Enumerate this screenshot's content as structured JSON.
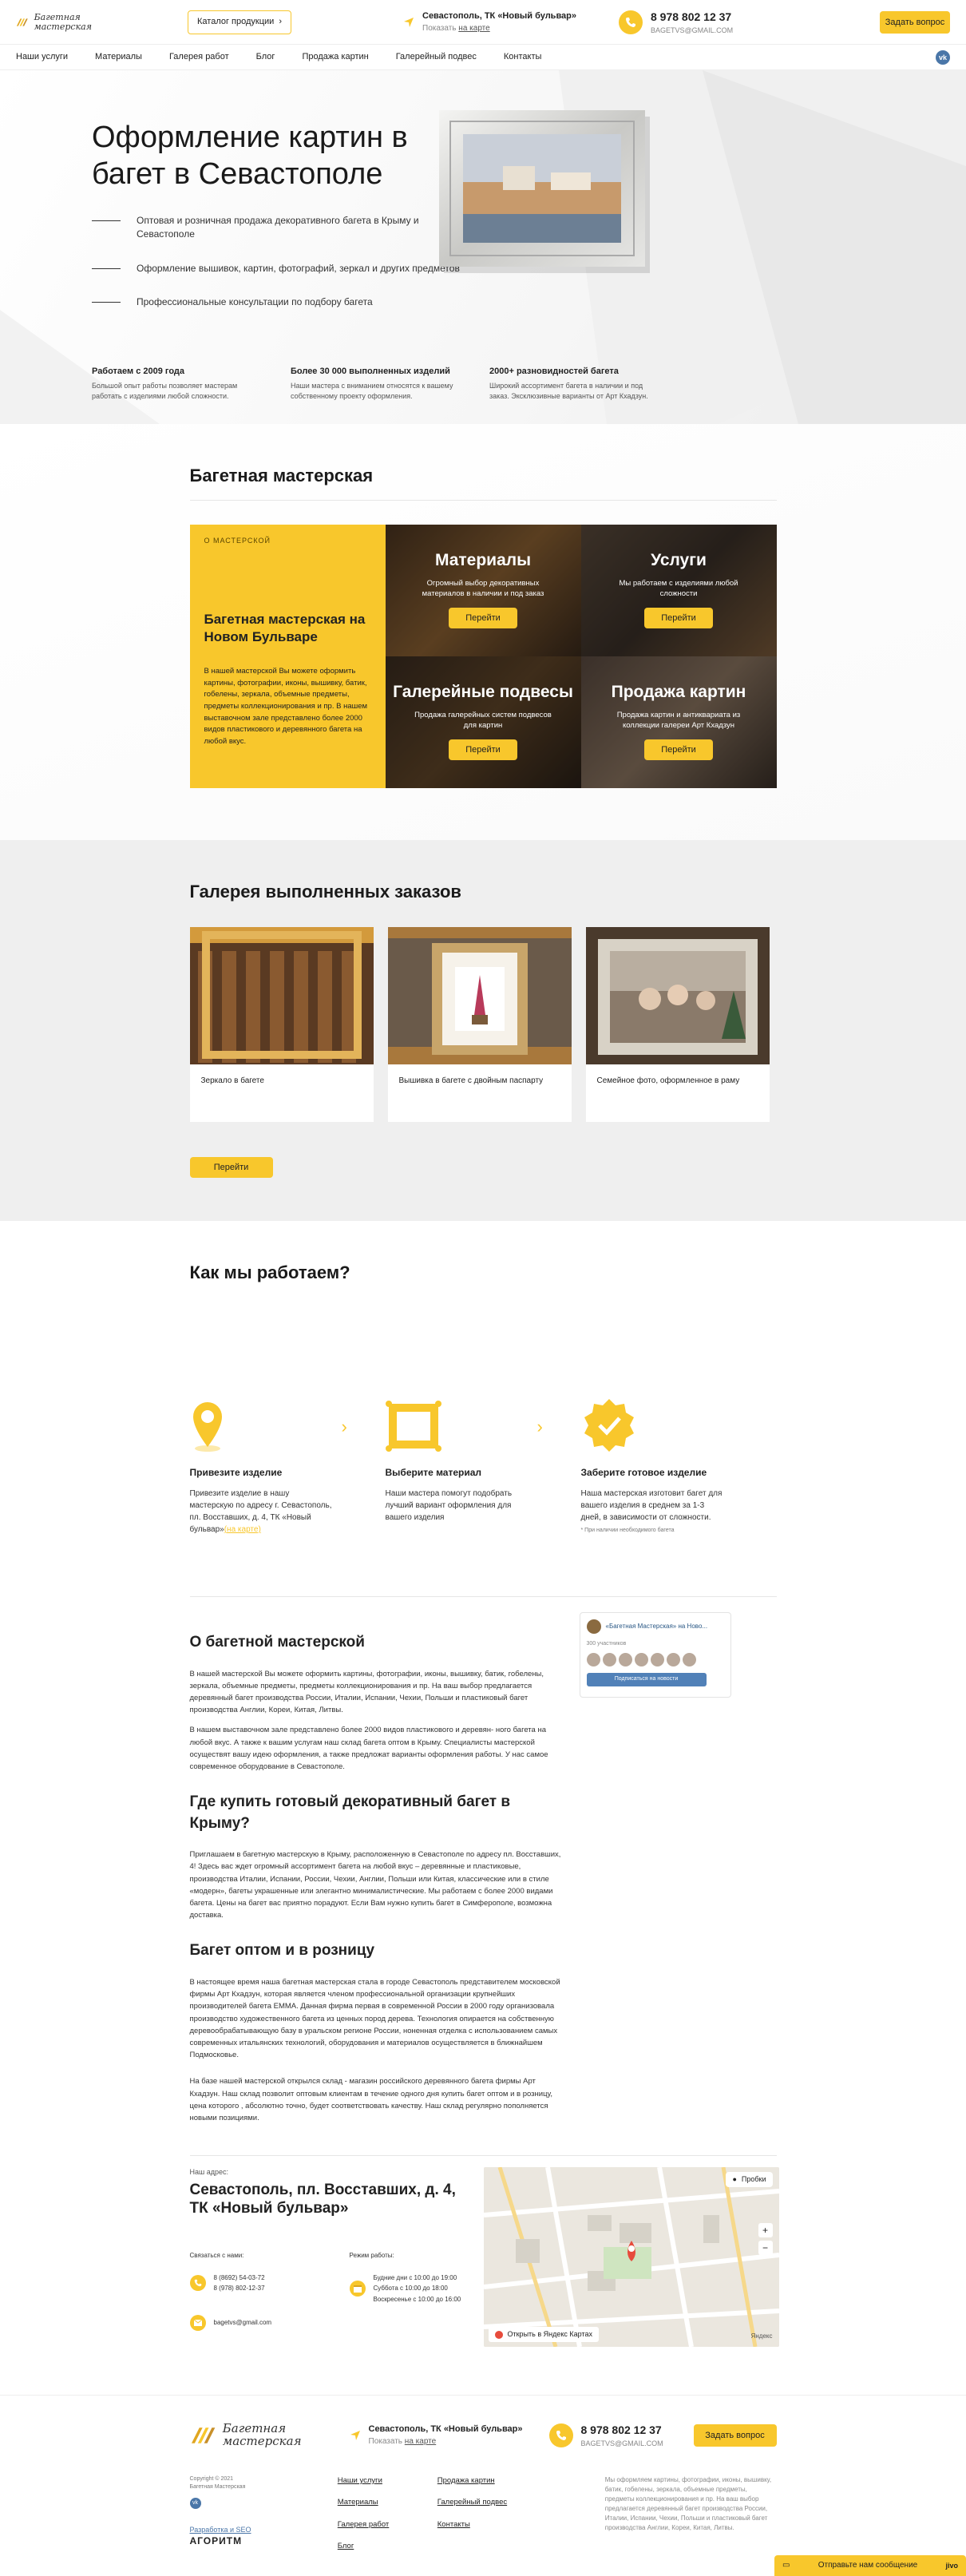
{
  "header": {
    "logo_line1": "Багетная",
    "logo_line2": "мастерская",
    "catalog_label": "Каталог продукции",
    "address_title": "Севастополь, ТК «Новый бульвар»",
    "address_show": "Показать",
    "address_map_link": "на карте",
    "phone": "8 978 802 12 37",
    "email": "BAGETVS@GMAIL.COM",
    "ask_label": "Задать вопрос"
  },
  "nav": {
    "items": [
      "Наши услуги",
      "Материалы",
      "Галерея работ",
      "Блог",
      "Продажа картин",
      "Галерейный подвес",
      "Контакты"
    ],
    "vk": "vk"
  },
  "hero": {
    "title": "Оформление картин в багет в Севастополе",
    "bullets": [
      "Оптовая и розничная продажа декоративного багета в Крыму и Севастополе",
      "Оформление вышивок, картин, фотографий, зеркал и других предметов",
      "Профессиональные консультации по подбору багета"
    ],
    "stats": [
      {
        "title": "Работаем с 2009 года",
        "text": "Большой опыт работы позволяет мастерам работать с изделиями любой сложности."
      },
      {
        "title": "Более 30 000 выполненных изделий",
        "text": "Наши мастера с вниманием относятся к вашему собственному проекту оформления."
      },
      {
        "title": "2000+ разновидностей багета",
        "text": "Широкий ассортимент багета в наличии и под заказ. Эксклюзивные варианты от Арт Кхадзун."
      }
    ]
  },
  "workshop": {
    "title": "Багетная мастерская",
    "card_tag": "О МАСТЕРСКОЙ",
    "card_title": "Багетная мастерская на Новом Бульваре",
    "card_text": "В нашей мастерской Вы можете оформить картины, фотографии, иконы, вышивку, батик, гобелены, зеркала, объемные предметы, предметы коллекционирования и пр. В нашем выставочном зале представлено более 2000 видов пластикового и деревянного багета на любой вкус.",
    "tiles": [
      {
        "title": "Материалы",
        "text": "Огромный выбор декоративных материалов в наличии и под заказ",
        "button": "Перейти"
      },
      {
        "title": "Услуги",
        "text": "Мы работаем с изделиями любой сложности",
        "button": "Перейти"
      },
      {
        "title": "Галерейные подвесы",
        "text": "Продажа галерейных систем подвесов для картин",
        "button": "Перейти"
      },
      {
        "title": "Продажа картин",
        "text": "Продажа картин и антиквариата из коллекции галереи Арт Кхадзун",
        "button": "Перейти"
      }
    ]
  },
  "gallery": {
    "title": "Галерея выполненных заказов",
    "items": [
      {
        "label": "Зеркало в багете"
      },
      {
        "label": "Вышивка в багете с двойным паспарту"
      },
      {
        "label": "Семейное фото, оформленное в раму"
      }
    ],
    "button": "Перейти"
  },
  "how": {
    "title": "Как мы работаем?",
    "steps": [
      {
        "title": "Привезите изделие",
        "text": "Привезите изделие в нашу мастерскую по адресу г. Севастополь, пл. Восставших, д. 4, ТК «Новый бульвар»",
        "link": "(на карте)"
      },
      {
        "title": "Выберите материал",
        "text": "Наши мастера помогут подобрать лучший вариант оформления для вашего изделия"
      },
      {
        "title": "Заберите готовое изделие",
        "text": "Наша мастерская изготовит багет для вашего изделия в среднем за 1-3 дней, в зависимости от сложности.",
        "footnote": "* При наличии необходимого багета"
      }
    ]
  },
  "vk_widget": {
    "group": "«Багетная Мастерская» на Ново...",
    "members": "300 участников",
    "subscribe": "Подписаться на новости"
  },
  "seo": {
    "h_about": "О багетной мастерской",
    "p_about1": "В нашей мастерской Вы можете оформить картины, фотографии, иконы, вышивку, батик, гобелены, зеркала, объемные предметы, предметы коллекционирования и пр. На ваш выбор предлагается деревянный багет производства России, Италии, Испании, Чехии, Польши и пластиковый багет производства Англии, Кореи, Китая, Литвы.",
    "p_about2": "В нашем выставочном зале представлено более 2000 видов пластикового и деревян- ного багета на любой вкус. А также к вашим услугам наш склад багета оптом в Крыму. Специалисты мастерской осуществят вашу идею оформления, а также предложат варианты оформления работы. У нас самое современное оборудование в Севастополе.",
    "h_where": "Где купить готовый декоративный багет в Крыму?",
    "p_where": "Приглашаем в багетную мастерскую в Крыму, расположенную в Севастополе по адресу пл. Восставших, 4! Здесь вас ждет огромный ассортимент багета на любой вкус – деревянные и пластиковые, производства Италии, Испании, России, Чехии, Англии, Польши или Китая, классические или в стиле «модерн», багеты украшенные или элегантно минималистические. Мы работаем с более 2000 видами багета. Цены на багет вас приятно порадуют. Если Вам нужно купить багет в Симферополе, возможна доставка.",
    "h_wholesale": "Багет оптом и в розницу",
    "p_whole1": "В настоящее время наша багетная мастерская стала в городе Севастополь представителем московской фирмы Арт Кхадзун, которая является членом профессиональной организации крупнейших производителей багета EMMA. Данная фирма первая в современной России в 2000 году организовала производство художественного багета из ценных пород дерева. Технология опирается на собственную деревообрабатывающую базу в уральском регионе России, ноненная отделка с использованием самых современных итальянских технологий, оборудования и материалов осуществляется в ближнайшем Подмосковье.",
    "p_whole2": "На базе нашей мастерской открылся склад - магазин российского деревянного багета фирмы Арт Кхадзун. Наш склад позволит оптовым клиентам в течение одного дня купить багет оптом и в розницу, цена которого , абсолютно точно, будет соответствовать качеству. Наш склад регулярно пополняется новыми позициями."
  },
  "contacts": {
    "label": "Наш адрес:",
    "address": "Севастополь, пл. Восставших, д. 4, ТК «Новый бульвар»",
    "contact_label": "Связаться с нами:",
    "phone1": "8 (8692) 54-03-72",
    "phone2": "8 (978) 802-12-37",
    "hours_label": "Режим работы:",
    "hours1": "Будние дни с 10:00 до 19:00",
    "hours2": "Суббота с 10:00 до 18:00",
    "hours3": "Воскресенье с 10:00 до 16:00",
    "email": "bagetvs@gmail.com",
    "map_open": "Открыть в Яндекс Картах",
    "map_traffic": "Пробки",
    "map_brand": "Яндекс"
  },
  "footer": {
    "copyright": "Copyright © 2021",
    "copyright2": "Багетная Мастерская",
    "dev_label": "Разработка и SEO",
    "dev_company": "АГОРИТМ",
    "links": [
      "Наши услуги",
      "Продажа картин",
      "Материалы",
      "Галерейный подвес",
      "Галерея работ",
      "Контакты",
      "Блог"
    ],
    "note": "Мы оформляем картины, фотографии, иконы, вышивку, батик, гобелены, зеркала, объемные предметы, предметы коллекционирования и пр. На ваш выбор предлагается деревянный багет производства России, Италии, Испании, Чехии, Польши и пластиковый багет производства Англии, Кореи, Китая, Литвы.",
    "chat": "Отправьте нам сообщение",
    "chat_icon": "jivo"
  },
  "colors": {
    "accent": "#f8c72c",
    "vk": "#4a76a8"
  }
}
